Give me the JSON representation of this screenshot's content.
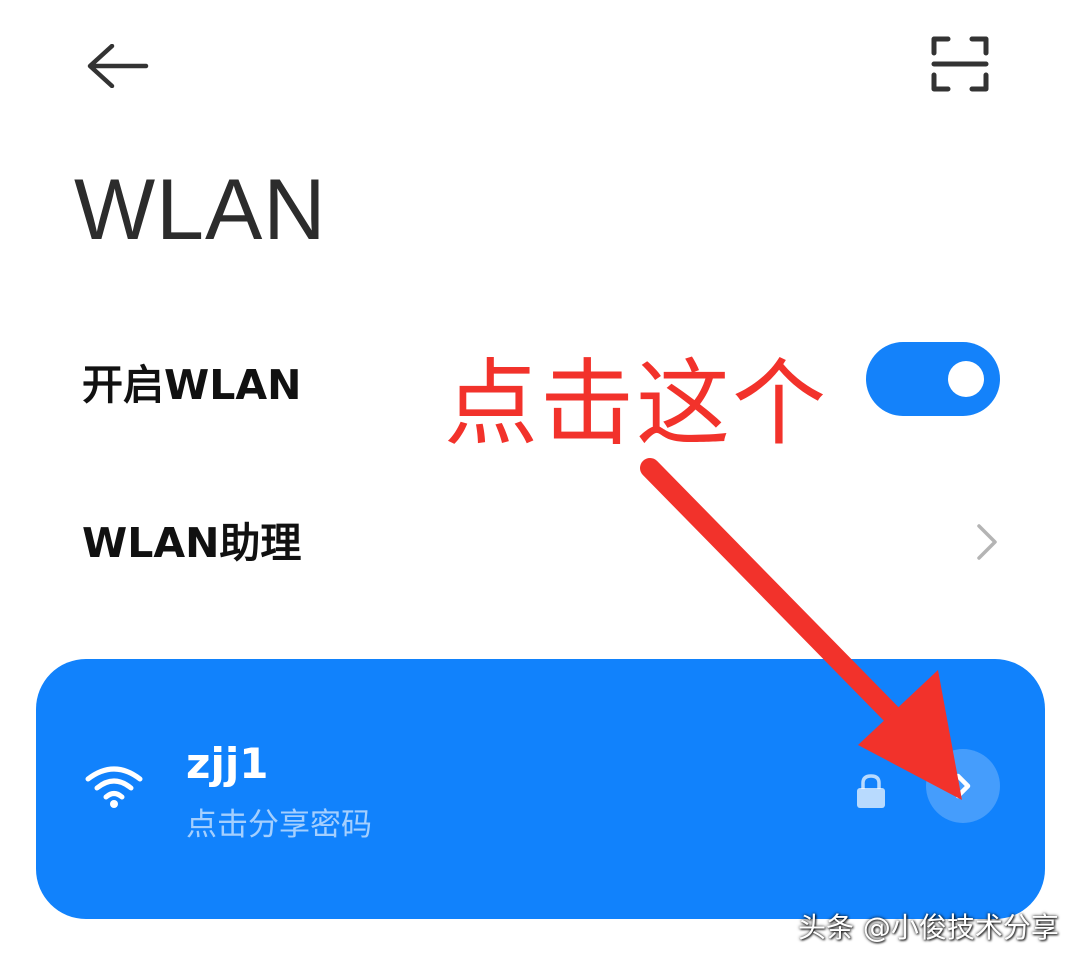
{
  "header": {
    "back_icon": "arrow-left-icon",
    "scan_icon": "scan-qr-icon"
  },
  "page_title": "WLAN",
  "settings": {
    "wlan_toggle": {
      "label": "开启WLAN",
      "enabled": true,
      "accent_color": "#1482fa"
    },
    "wlan_assistant": {
      "label": "WLAN助理",
      "chevron_icon": "chevron-right-icon"
    }
  },
  "connected_network": {
    "ssid": "zjj1",
    "subtitle": "点击分享密码",
    "signal_icon": "wifi-icon",
    "lock_icon": "lock-icon",
    "detail_icon": "chevron-right-icon",
    "card_color": "#1182fc"
  },
  "annotation": {
    "text": "点击这个",
    "color": "#f2322b"
  },
  "watermark": {
    "text": "头条 @小俊技术分享"
  }
}
